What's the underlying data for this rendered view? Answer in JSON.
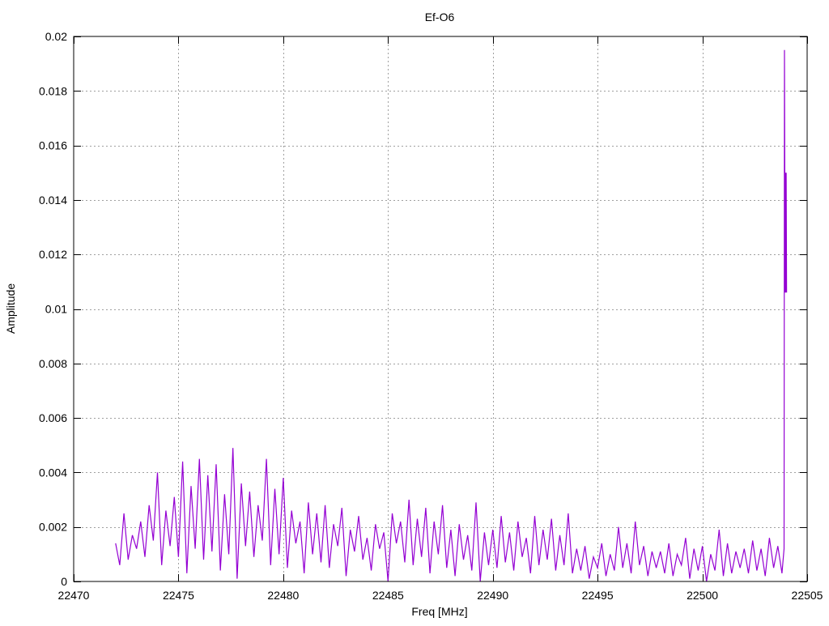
{
  "chart_data": {
    "type": "line",
    "title": "Ef-O6",
    "xlabel": "Freq [MHz]",
    "ylabel": "Amplitude",
    "xlim": [
      22470,
      22505
    ],
    "ylim": [
      0,
      0.02
    ],
    "xticks": [
      "22470",
      "22475",
      "22480",
      "22485",
      "22490",
      "22495",
      "22500",
      "22505"
    ],
    "xtick_values": [
      22470,
      22475,
      22480,
      22485,
      22490,
      22495,
      22500,
      22505
    ],
    "yticks": [
      "0",
      "0.002",
      "0.004",
      "0.006",
      "0.008",
      "0.01",
      "0.012",
      "0.014",
      "0.016",
      "0.018",
      "0.02"
    ],
    "ytick_values": [
      0,
      0.002,
      0.004,
      0.006,
      0.008,
      0.01,
      0.012,
      0.014,
      0.016,
      0.018,
      0.02
    ],
    "grid": true,
    "legend": "none",
    "series": [
      {
        "name": "Ef-O6",
        "color": "#9400d3",
        "x_start": 22472.0,
        "x_step": 0.2,
        "y": [
          0.0014,
          0.0006,
          0.0025,
          0.0008,
          0.0017,
          0.0012,
          0.0022,
          0.0009,
          0.0028,
          0.0015,
          0.004,
          0.0006,
          0.0026,
          0.0013,
          0.0031,
          0.0009,
          0.0044,
          0.0003,
          0.0035,
          0.0012,
          0.0045,
          0.0008,
          0.0039,
          0.0011,
          0.0043,
          0.0004,
          0.0032,
          0.001,
          0.0049,
          0.0001,
          0.0036,
          0.0013,
          0.0033,
          0.0009,
          0.0028,
          0.0015,
          0.0045,
          0.0006,
          0.0034,
          0.001,
          0.0038,
          0.0005,
          0.0026,
          0.0014,
          0.0022,
          0.0003,
          0.0029,
          0.001,
          0.0025,
          0.0007,
          0.0028,
          0.0005,
          0.0021,
          0.0013,
          0.0027,
          0.0002,
          0.0019,
          0.0011,
          0.0024,
          0.0008,
          0.0016,
          0.0004,
          0.0021,
          0.0012,
          0.0018,
          0.0,
          0.0025,
          0.0014,
          0.0022,
          0.0007,
          0.003,
          0.0006,
          0.0023,
          0.0009,
          0.0027,
          0.0003,
          0.0022,
          0.001,
          0.0028,
          0.0005,
          0.0019,
          0.0002,
          0.0021,
          0.0008,
          0.0017,
          0.0004,
          0.0029,
          0.0,
          0.0018,
          0.0006,
          0.0019,
          0.0005,
          0.0024,
          0.0007,
          0.0018,
          0.0004,
          0.0022,
          0.0009,
          0.0016,
          0.0003,
          0.0024,
          0.0006,
          0.0019,
          0.0008,
          0.0023,
          0.0004,
          0.0017,
          0.0006,
          0.0025,
          0.0003,
          0.0012,
          0.0004,
          0.0013,
          0.0001,
          0.0009,
          0.0005,
          0.0014,
          0.0002,
          0.001,
          0.0004,
          0.002,
          0.0005,
          0.0014,
          0.0003,
          0.0022,
          0.0006,
          0.0013,
          0.0002,
          0.0011,
          0.0005,
          0.0011,
          0.0003,
          0.0014,
          0.0002,
          0.001,
          0.0006,
          0.0016,
          0.0001,
          0.0012,
          0.0004,
          0.0013,
          0.0,
          0.001,
          0.0004,
          0.0019,
          0.0002,
          0.0014,
          0.0003,
          0.0011,
          0.0005,
          0.0012,
          0.0003,
          0.0015,
          0.0004,
          0.0012,
          0.0002,
          0.0016,
          0.0005,
          0.0013,
          0.0003
        ],
        "tail_x": [
          22503.9,
          22503.92,
          22503.95,
          22503.97,
          22503.98,
          22504.0,
          22504.02
        ],
        "tail_y": [
          0.0012,
          0.0195,
          0.0106,
          0.015,
          0.0106,
          0.015,
          0.0106
        ]
      }
    ]
  }
}
